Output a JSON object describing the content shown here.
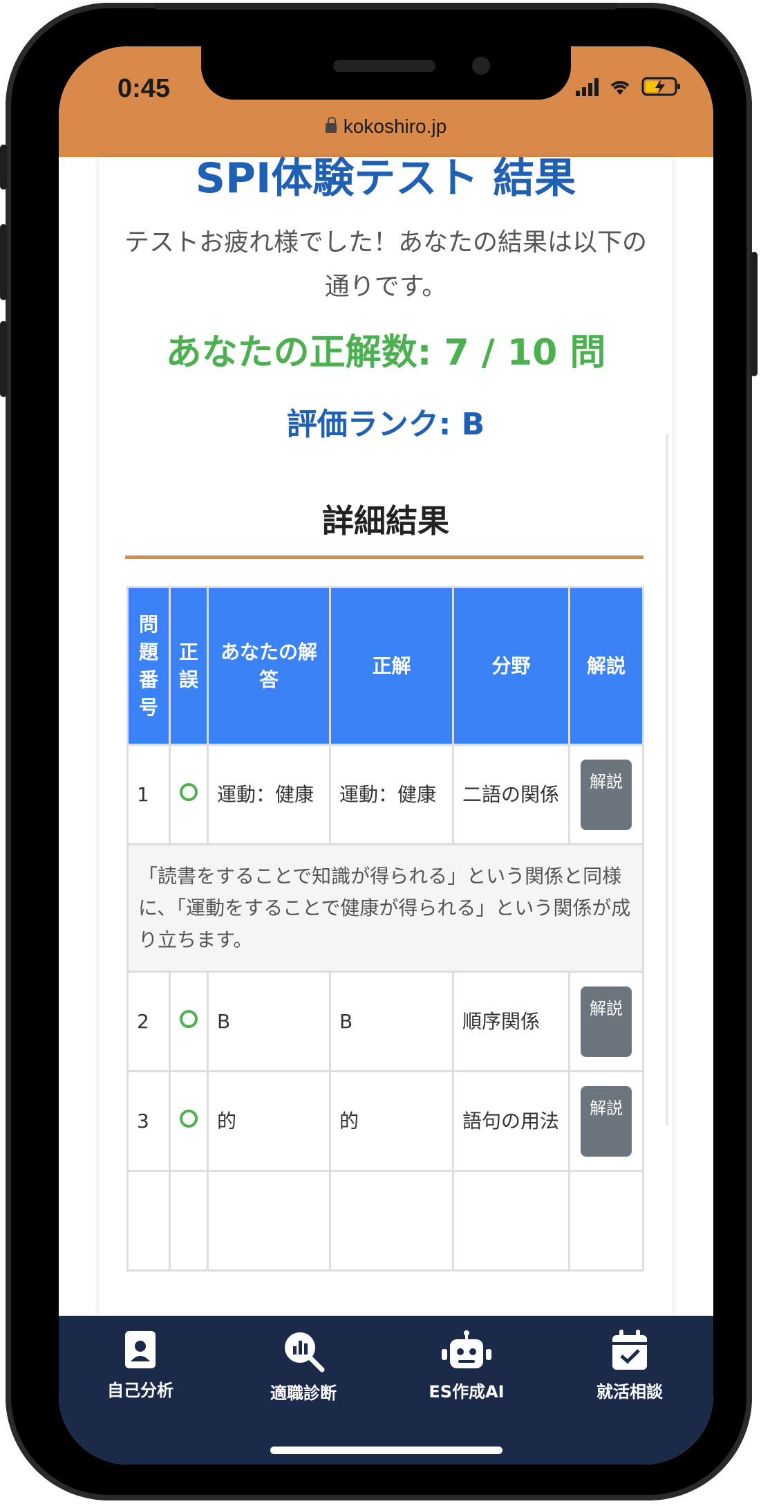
{
  "status_bar": {
    "time": "0:45",
    "url": "kokoshiro.jp"
  },
  "page": {
    "title": "SPI体験テスト 結果",
    "subtitle": "テストお疲れ様でした！あなたの結果は以下の通りです。",
    "score_text": "あなたの正解数: 7 / 10 問",
    "rank_text": "評価ランク: B",
    "detail_heading": "詳細結果"
  },
  "table": {
    "headers": [
      "問題番号",
      "正誤",
      "あなたの解答",
      "正解",
      "分野",
      "解説"
    ],
    "rows": [
      {
        "no": "1",
        "answer": "運動：健康",
        "correct": "運動：健康",
        "field": "二語の関係",
        "button": "解説",
        "explanation": "「読書をすることで知識が得られる」という関係と同様に、「運動をすることで健康が得られる」という関係が成り立ちます。"
      },
      {
        "no": "2",
        "answer": "B",
        "correct": "B",
        "field": "順序関係",
        "button": "解説"
      },
      {
        "no": "3",
        "answer": "的",
        "correct": "的",
        "field": "語句の用法",
        "button": "解説"
      }
    ]
  },
  "bottom_nav": [
    {
      "label": "自己分析",
      "icon": "id-card-icon"
    },
    {
      "label": "適職診断",
      "icon": "chart-search-icon"
    },
    {
      "label": "ES作成AI",
      "icon": "robot-icon"
    },
    {
      "label": "就活相談",
      "icon": "calendar-check-icon"
    }
  ],
  "colors": {
    "status_bar": "#d98a4a",
    "title_blue": "#1f5fb4",
    "score_green": "#4caf50",
    "table_header": "#3b82f6",
    "nav_bg": "#1c2a4a"
  }
}
